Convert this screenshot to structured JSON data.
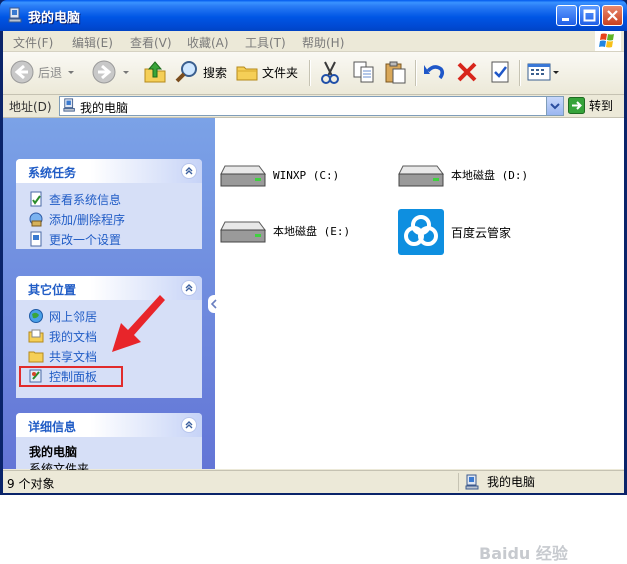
{
  "window": {
    "title": "我的电脑"
  },
  "menubar": {
    "items": [
      "文件(F)",
      "编辑(E)",
      "查看(V)",
      "收藏(A)",
      "工具(T)",
      "帮助(H)"
    ]
  },
  "toolbar": {
    "back_label": "后退",
    "search_label": "搜索",
    "folders_label": "文件夹"
  },
  "address": {
    "label": "地址(D)",
    "value": "我的电脑",
    "go_label": "转到"
  },
  "tasks": {
    "system": {
      "title": "系统任务",
      "items": [
        "查看系统信息",
        "添加/删除程序",
        "更改一个设置"
      ]
    },
    "other": {
      "title": "其它位置",
      "items": [
        "网上邻居",
        "我的文档",
        "共享文档",
        "控制面板"
      ]
    },
    "details": {
      "title": "详细信息",
      "name": "我的电脑",
      "type": "系统文件夹"
    }
  },
  "drives": [
    {
      "label": "WINXP (C:)",
      "icon": "hard-drive-icon"
    },
    {
      "label": "本地磁盘 (D:)",
      "icon": "hard-drive-icon"
    },
    {
      "label": "本地磁盘 (E:)",
      "icon": "hard-drive-icon"
    },
    {
      "label": "百度云管家",
      "icon": "baidu-cloud-icon"
    }
  ],
  "status": {
    "count": "9 个对象",
    "location": "我的电脑"
  },
  "watermark": "Baidu 经验",
  "colors": {
    "task_link": "#215dc6",
    "highlight": "#e12b2b",
    "baidu": "#0e8fe0"
  }
}
